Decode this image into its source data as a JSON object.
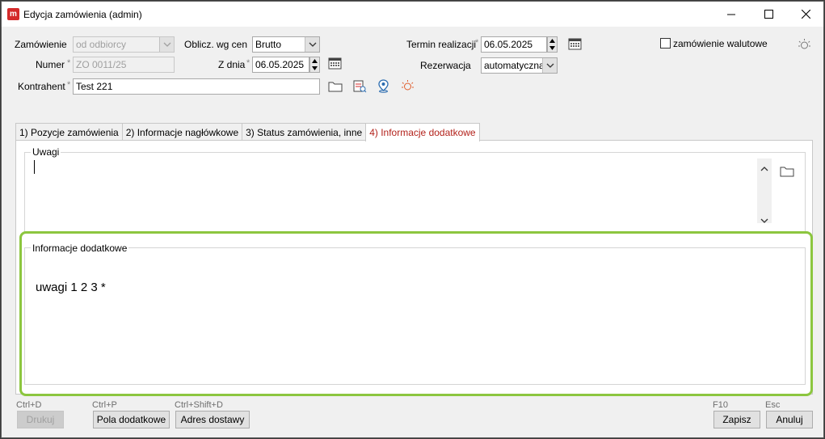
{
  "window": {
    "title": "Edycja zamówienia (admin)",
    "app_icon_letter": "m"
  },
  "form": {
    "zamowienie_label": "Zamówienie",
    "zamowienie_value": "od odbiorcy",
    "oblicz_label": "Oblicz. wg cen",
    "oblicz_value": "Brutto",
    "termin_label": "Termin realizacji",
    "termin_value": "06.05.2025",
    "walutowe_label": "zamówienie walutowe",
    "numer_label": "Numer",
    "numer_value": "ZO 0011/25",
    "zdnia_label": "Z dnia",
    "zdnia_value": "06.05.2025",
    "rezerwacja_label": "Rezerwacja",
    "rezerwacja_value": "automatyczna",
    "kontrahent_label": "Kontrahent",
    "kontrahent_value": "Test 221",
    "required_mark": "*"
  },
  "tabs": [
    {
      "label": "1) Pozycje zamówienia"
    },
    {
      "label": "2) Informacje nagłówkowe"
    },
    {
      "label": "3) Status zamówienia, inne"
    },
    {
      "label": "4) Informacje dodatkowe"
    }
  ],
  "panel": {
    "uwagi_title": "Uwagi",
    "uwagi_value": "",
    "info_title": "Informacje dodatkowe",
    "info_value": "uwagi 1 2 3 *"
  },
  "footer": {
    "drukuj_shortcut": "Ctrl+D",
    "drukuj_label": "Drukuj",
    "pola_shortcut": "Ctrl+P",
    "pola_label": "Pola dodatkowe",
    "adres_shortcut": "Ctrl+Shift+D",
    "adres_label": "Adres dostawy",
    "zapisz_shortcut": "F10",
    "zapisz_label": "Zapisz",
    "anuluj_shortcut": "Esc",
    "anuluj_label": "Anuluj"
  },
  "colors": {
    "active_tab": "#b3221b",
    "highlight_border": "#8cc63f",
    "app_icon": "#d42a2a"
  }
}
